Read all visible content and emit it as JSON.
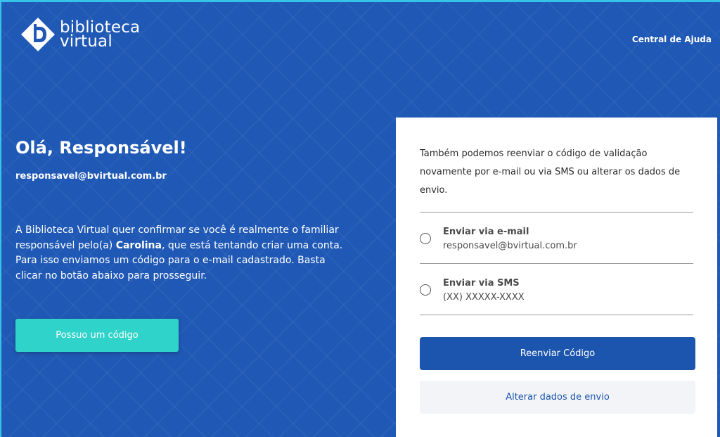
{
  "header": {
    "logo_line1": "biblioteca",
    "logo_line2": "virtual",
    "help_link": "Central de Ajuda"
  },
  "left": {
    "greeting": "Olá, Responsável!",
    "email": "responsavel@bvirtual.com.br",
    "intro_before": "A Biblioteca Virtual quer confirmar se você é realmente o familiar responsável pelo(a) ",
    "intro_name": "Carolina",
    "intro_after": ", que está tentando criar uma conta. Para isso enviamos um código para o e-mail cadastrado. Basta clicar no botão abaixo para prosseguir.",
    "code_button": "Possuo um código"
  },
  "card": {
    "text": "Também podemos reenviar o código de validação novamente por e-mail ou via SMS ou alterar os dados de envio.",
    "options": [
      {
        "title": "Enviar via e-mail",
        "value": "responsavel@bvirtual.com.br"
      },
      {
        "title": "Enviar via SMS",
        "value": "(XX) XXXXX-XXXX"
      }
    ],
    "resend_button": "Reenviar Código",
    "alter_button": "Alterar dados de envio"
  },
  "colors": {
    "background": "#2059b5",
    "accent_teal": "#2fd3c9",
    "primary_button": "#1b55ad",
    "secondary_button": "#f3f4f8"
  }
}
